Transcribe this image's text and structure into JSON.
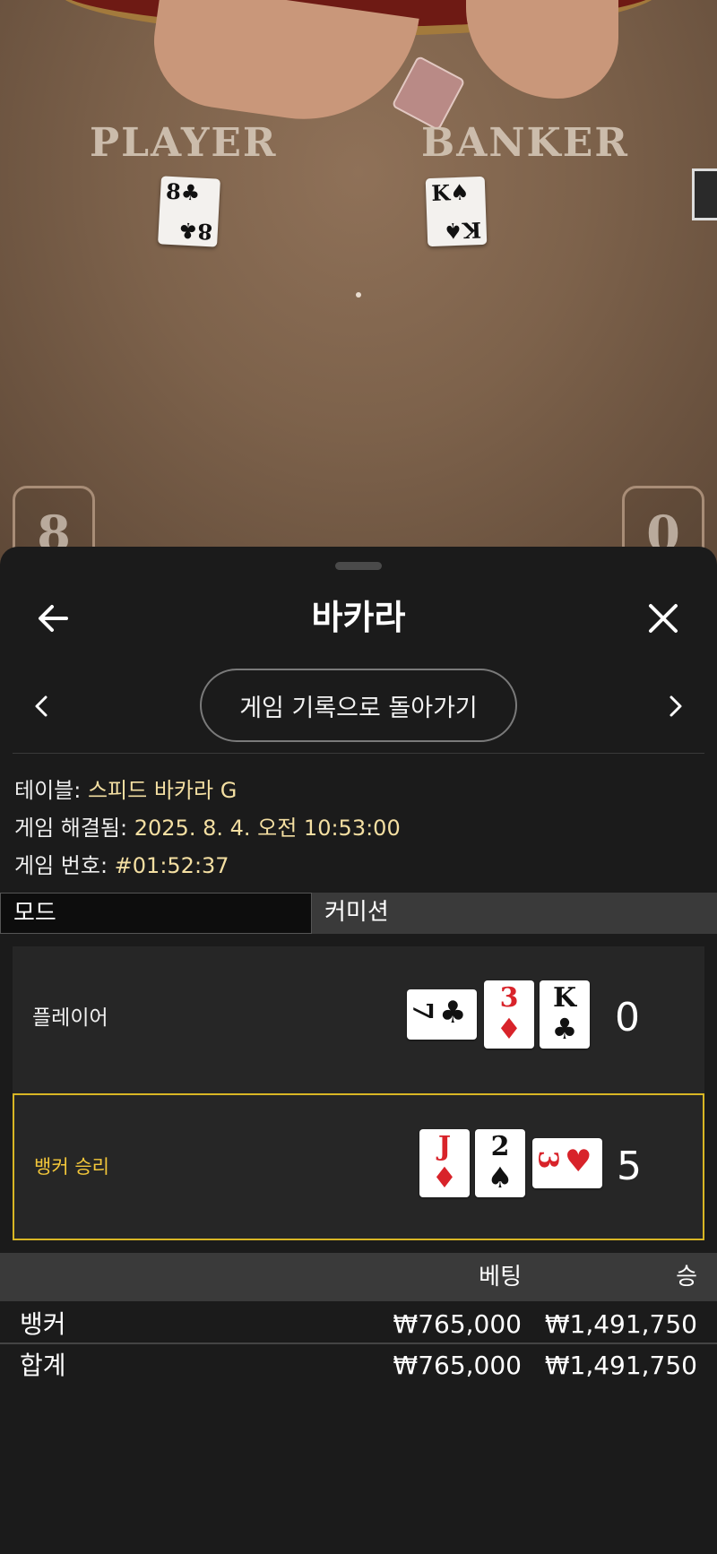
{
  "table": {
    "player_label": "PLAYER",
    "banker_label": "BANKER",
    "player_card": {
      "rank": "8",
      "suit": "♣"
    },
    "banker_card": {
      "rank": "K",
      "suit": "♠"
    },
    "player_score": "8",
    "banker_score": "0"
  },
  "sheet": {
    "title": "바카라",
    "history_button": "게임 기록으로 돌아가기",
    "info": {
      "table_label": "테이블: ",
      "table_value": "스피드 바카라 G",
      "resolved_label": "게임 해결됨: ",
      "resolved_value": "2025. 8. 4. 오전 10:53:00",
      "number_label": "게임 번호: ",
      "number_value": "#01:52:37"
    },
    "mode": {
      "label": "모드",
      "value": "커미션"
    },
    "hands": {
      "player": {
        "label": "플레이어",
        "score": "0",
        "cards": [
          {
            "rank": "7",
            "suit": "♣",
            "color": "black"
          },
          {
            "rank": "3",
            "suit": "♦",
            "color": "red"
          },
          {
            "rank": "K",
            "suit": "♣",
            "color": "black"
          }
        ]
      },
      "banker": {
        "label": "뱅커 승리",
        "score": "5",
        "cards": [
          {
            "rank": "J",
            "suit": "♦",
            "color": "red"
          },
          {
            "rank": "2",
            "suit": "♠",
            "color": "black"
          },
          {
            "rank": "3",
            "suit": "♥",
            "color": "red"
          }
        ]
      }
    },
    "bets": {
      "header_bet": "베팅",
      "header_win": "승",
      "rows": [
        {
          "name": "뱅커",
          "bet": "₩765,000",
          "win": "₩1,491,750"
        },
        {
          "name": "합계",
          "bet": "₩765,000",
          "win": "₩1,491,750"
        }
      ]
    }
  },
  "colors": {
    "accent": "#f3c73a",
    "info_value": "#f4dfa2",
    "background": "#1b1b1b"
  }
}
